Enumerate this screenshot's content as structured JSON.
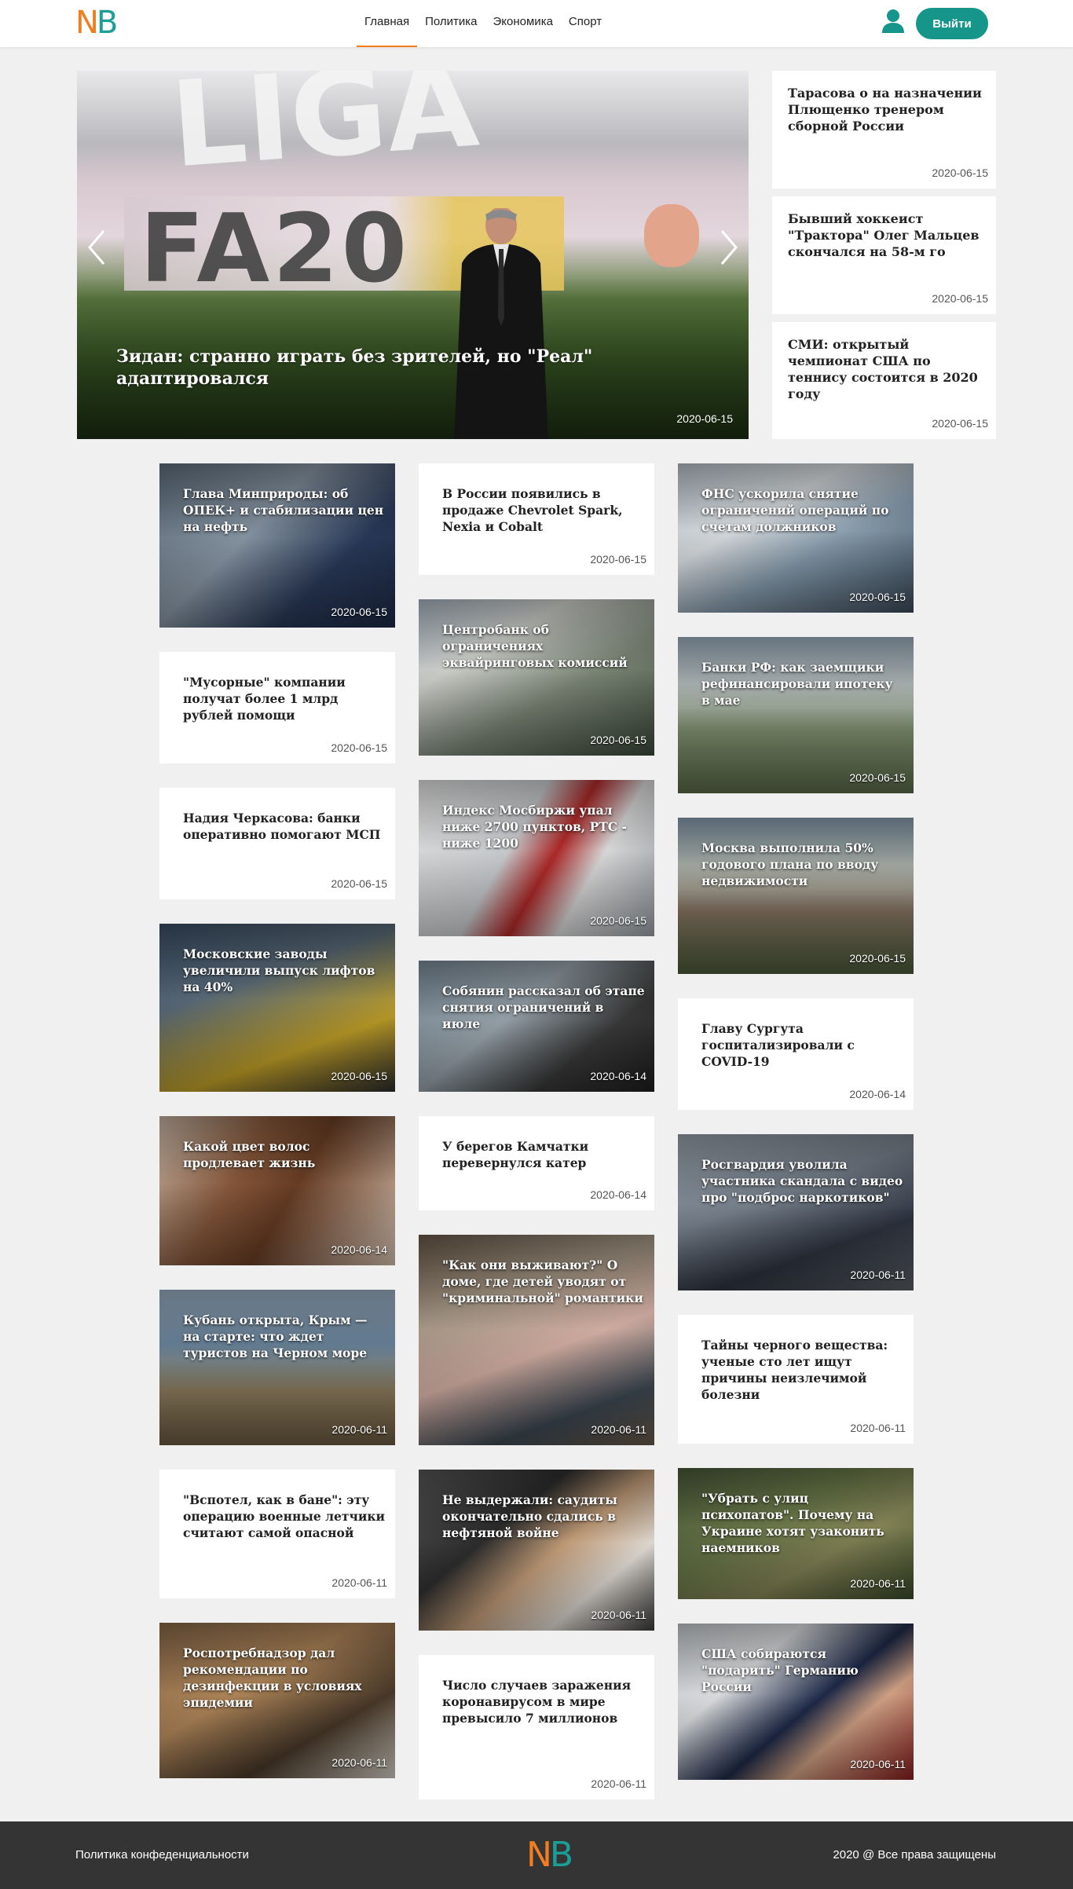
{
  "header": {
    "logo": {
      "n": "N",
      "b": "B"
    },
    "nav": [
      "Главная",
      "Политика",
      "Экономика",
      "Спорт"
    ],
    "active_nav": "Главная",
    "logout_label": "Выйти",
    "accent_color": "#16968b",
    "orange_color": "#f07d1e"
  },
  "hero": {
    "title": "Зидан: странно играть без зрителей, но \"Реал\" адаптировался",
    "date": "2020-06-15",
    "board_text": "FA20"
  },
  "side_news": [
    {
      "title": "Тарасова о на назначении Плющенко тренером сборной России",
      "date": "2020-06-15"
    },
    {
      "title": "Бывший хоккеист \"Трактора\" Олег Мальцев скончался на 58-м го",
      "date": "2020-06-15"
    },
    {
      "title": "СМИ: открытый чемпионат США по теннису состоится в 2020 году",
      "date": "2020-06-15"
    }
  ],
  "columns": [
    [
      {
        "title": "Глава Минприроды: об ОПЕК+ и стабилизации цен на нефть",
        "date": "2020-06-15"
      },
      {
        "title": "\"Мусорные\" компании получат более 1 млрд рублей помощи",
        "date": "2020-06-15"
      },
      {
        "title": "Надия Черкасова: банки оперативно помогают МСП",
        "date": "2020-06-15"
      },
      {
        "title": "Московские заводы увеличили выпуск лифтов на 40%",
        "date": "2020-06-15"
      },
      {
        "title": "Какой цвет волос продлевает жизнь",
        "date": "2020-06-14"
      },
      {
        "title": "Кубань открыта, Крым — на старте: что ждет туристов на Черном море",
        "date": "2020-06-11"
      },
      {
        "title": "\"Вспотел, как в бане\": эту операцию военные летчики считают самой опасной",
        "date": "2020-06-11"
      },
      {
        "title": "Роспотребнадзор дал рекомендации по дезинфекции в условиях эпидемии",
        "date": "2020-06-11"
      }
    ],
    [
      {
        "title": "В России появились в продаже Chevrolet Spark, Nexia и Cobalt",
        "date": "2020-06-15"
      },
      {
        "title": "Центробанк об ограничениях эквайринговых комиссий",
        "date": "2020-06-15"
      },
      {
        "title": "Индекс Мосбиржи упал ниже 2700 пунктов, РТС - ниже 1200",
        "date": "2020-06-15"
      },
      {
        "title": "Собянин рассказал об этапе снятия ограничений в июле",
        "date": "2020-06-14"
      },
      {
        "title": "У берегов Камчатки перевернулся катер",
        "date": "2020-06-14"
      },
      {
        "title": "\"Как они выживают?\" О доме, где детей уводят от \"криминальной\" романтики",
        "date": "2020-06-11"
      },
      {
        "title": "Не выдержали: саудиты окончательно сдались в нефтяной войне",
        "date": "2020-06-11"
      },
      {
        "title": "Число случаев заражения коронавирусом в мире превысило 7 миллионов",
        "date": "2020-06-11"
      }
    ],
    [
      {
        "title": "ФНС ускорила снятие ограничений операций по счетам должников",
        "date": "2020-06-15"
      },
      {
        "title": "Банки РФ: как заемщики рефинансировали ипотеку в мае",
        "date": "2020-06-15"
      },
      {
        "title": "Москва выполнила 50% годового плана по вводу недвижимости",
        "date": "2020-06-15"
      },
      {
        "title": "Главу Сургута госпитализировали с COVID-19",
        "date": "2020-06-14"
      },
      {
        "title": "Росгвардия уволила участника скандала с видео про \"подброс наркотиков\"",
        "date": "2020-06-11"
      },
      {
        "title": "Тайны черного вещества: ученые сто лет ищут причины неизлечимой болезни",
        "date": "2020-06-11"
      },
      {
        "title": "\"Убрать с улиц психопатов\". Почему на Украине хотят узаконить наемников",
        "date": "2020-06-11"
      },
      {
        "title": "США собираются \"подарить\" Германию России",
        "date": "2020-06-11"
      }
    ]
  ],
  "footer": {
    "privacy": "Политика конфеденциальности",
    "copyright": "2020 @ Все права защищены",
    "logo": {
      "n": "N",
      "b": "B"
    }
  }
}
